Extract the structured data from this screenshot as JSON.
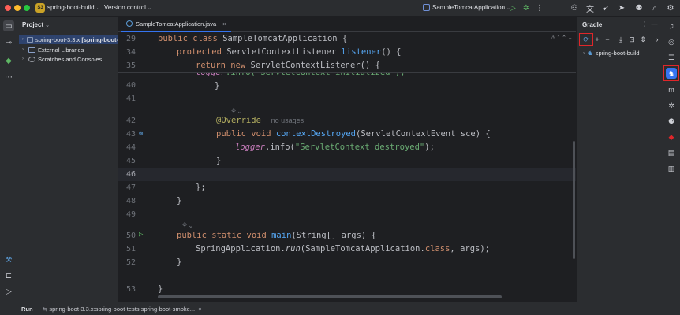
{
  "titlebar": {
    "project_badge": "S3",
    "project_name": "spring-boot-build",
    "version_control": "Version control",
    "run_config": "SampleTomcatApplication"
  },
  "project_panel": {
    "title": "Project",
    "items": [
      {
        "name": "spring-boot-3.3.x",
        "suffix": "[spring-boot-"
      },
      {
        "name": "External Libraries"
      },
      {
        "name": "Scratches and Consoles"
      }
    ]
  },
  "editor": {
    "tab": "SampleTomcatApplication.java",
    "warning_count": "1",
    "sticky": [
      {
        "num": "29",
        "text": ""
      },
      {
        "num": "34",
        "text": ""
      },
      {
        "num": "35",
        "text": ""
      }
    ],
    "line_numbers": [
      "40",
      "41",
      "42",
      "43",
      "44",
      "45",
      "46",
      "47",
      "48",
      "49",
      "50",
      "51",
      "52",
      "53"
    ],
    "override_hint": "no usages"
  },
  "gradle": {
    "title": "Gradle",
    "root": "spring-boot-build"
  },
  "statusbar": {
    "run_label": "Run",
    "config": "spring-boot-3.3.x:spring-boot-tests:spring-boot-smoke..."
  }
}
